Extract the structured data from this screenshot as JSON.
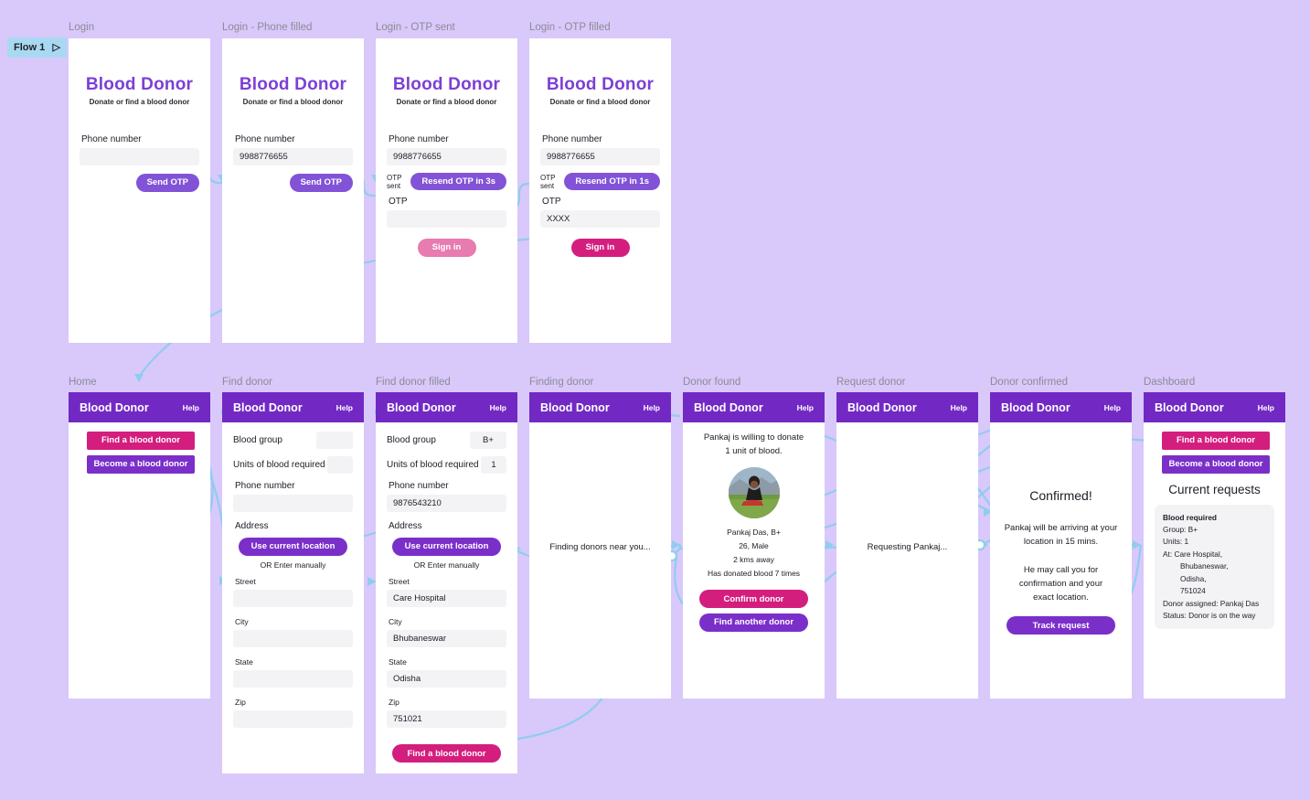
{
  "flow": {
    "label": "Flow 1",
    "play_icon": "play-triangle-icon"
  },
  "colors": {
    "background": "#d9c8fa",
    "header_purple": "#7229c4",
    "brand_purple": "#7c3fd4",
    "button_purple": "#8253d6",
    "button_pink": "#d41e7e",
    "button_pink_disabled": "#e87bb0",
    "connector_blue": "#8fcdef",
    "flow_badge_blue": "#a9d8f2"
  },
  "brand": {
    "title": "Blood Donor",
    "tagline": "Donate or find a blood donor"
  },
  "app_bar": {
    "title": "Blood Donor",
    "help": "Help"
  },
  "frames": {
    "login": {
      "label": "Login",
      "phone_label": "Phone number",
      "phone_value": "",
      "phone_placeholder": "",
      "send_otp": "Send OTP"
    },
    "login_phone_filled": {
      "label": "Login - Phone filled",
      "phone_label": "Phone number",
      "phone_value": "9988776655",
      "send_otp": "Send OTP"
    },
    "login_otp_sent": {
      "label": "Login - OTP sent",
      "phone_label": "Phone number",
      "phone_value": "9988776655",
      "otp_sent_label": "OTP sent",
      "resend_label": "Resend OTP in 3s",
      "otp_label": "OTP",
      "otp_value": "",
      "sign_in": "Sign in"
    },
    "login_otp_filled": {
      "label": "Login - OTP filled",
      "phone_label": "Phone number",
      "phone_value": "9988776655",
      "otp_sent_label": "OTP sent",
      "resend_label": "Resend OTP in 1s",
      "otp_label": "OTP",
      "otp_value": "XXXX",
      "sign_in": "Sign in"
    },
    "home": {
      "label": "Home",
      "find_donor_button": "Find a blood donor",
      "become_donor_button": "Become a blood donor"
    },
    "find_donor": {
      "label": "Find donor",
      "blood_group_label": "Blood group",
      "blood_group_value": "",
      "units_label": "Units of blood required",
      "units_value": "",
      "phone_label": "Phone number",
      "phone_value": "",
      "address_label": "Address",
      "use_location_button": "Use current location",
      "or_manual": "OR Enter manually",
      "street_label": "Street",
      "street_value": "",
      "city_label": "City",
      "city_value": "",
      "state_label": "State",
      "state_value": "",
      "zip_label": "Zip",
      "zip_value": ""
    },
    "find_donor_filled": {
      "label": "Find donor filled",
      "blood_group_label": "Blood group",
      "blood_group_value": "B+",
      "units_label": "Units of blood required",
      "units_value": "1",
      "phone_label": "Phone number",
      "phone_value": "9876543210",
      "address_label": "Address",
      "use_location_button": "Use current location",
      "or_manual": "OR Enter manually",
      "street_label": "Street",
      "street_value": "Care Hospital",
      "city_label": "City",
      "city_value": "Bhubaneswar",
      "state_label": "State",
      "state_value": "Odisha",
      "zip_label": "Zip",
      "zip_value": "751021",
      "submit_button": "Find a blood donor"
    },
    "finding_donor": {
      "label": "Finding donor",
      "status_text": "Finding donors near you..."
    },
    "donor_found": {
      "label": "Donor found",
      "headline_line1": "Pankaj is willing to donate",
      "headline_line2": "1 unit of blood.",
      "photo": "donor-photo",
      "detail_name_group": "Pankaj Das, B+",
      "detail_age_gender": "26, Male",
      "detail_distance": "2 kms away",
      "detail_history": "Has donated blood 7 times",
      "confirm_button": "Confirm donor",
      "find_another_button": "Find another donor"
    },
    "request_donor": {
      "label": "Request donor",
      "status_text": "Requesting Pankaj..."
    },
    "donor_confirmed": {
      "label": "Donor confirmed",
      "heading": "Confirmed!",
      "line1": "Pankaj will be arriving at your",
      "line2": "location in 15 mins.",
      "line3": "He may call you for",
      "line4": "confirmation and your",
      "line5": "exact location.",
      "track_button": "Track request"
    },
    "dashboard": {
      "label": "Dashboard",
      "find_donor_button": "Find a blood donor",
      "become_donor_button": "Become a blood donor",
      "section_title": "Current requests",
      "card": {
        "title": "Blood required",
        "group": "Group: B+",
        "units": "Units: 1",
        "at": "At: Care Hospital,",
        "city": "Bhubaneswar,",
        "state": "Odisha,",
        "zip": "751024",
        "donor": "Donor assigned: Pankaj Das",
        "status": "Status: Donor is on the way"
      }
    }
  }
}
